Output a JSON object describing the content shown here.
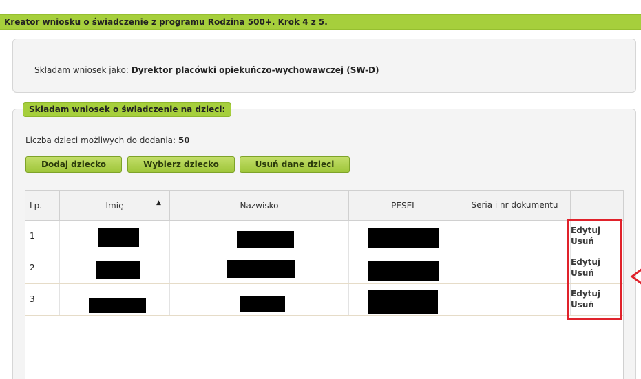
{
  "header": {
    "title": "Kreator wniosku o świadczenie z programu Rodzina 500+. Krok 4 z 5."
  },
  "role": {
    "prefix": "Składam wniosek jako:",
    "value": "Dyrektor placówki opiekuńczo-wychowawczej (SW-D)"
  },
  "children_section": {
    "legend": "Składam wniosek o świadczenie na dzieci:",
    "count_label": "Liczba dzieci możliwych do dodania:",
    "count_value": "50",
    "buttons": {
      "add": "Dodaj dziecko",
      "choose": "Wybierz dziecko",
      "remove": "Usuń dane dzieci"
    }
  },
  "table": {
    "columns": {
      "lp": "Lp.",
      "imie": "Imię",
      "nazwisko": "Nazwisko",
      "pesel": "PESEL",
      "seria": "Seria i nr dokumentu"
    },
    "sort_icon": "sort-ascending-icon",
    "rows": [
      {
        "lp": "1",
        "edit": "Edytuj",
        "delete": "Usuń"
      },
      {
        "lp": "2",
        "edit": "Edytuj",
        "delete": "Usuń"
      },
      {
        "lp": "3",
        "edit": "Edytuj",
        "delete": "Usuń"
      }
    ]
  },
  "colors": {
    "accent_green": "#a6cf3c",
    "highlight_red": "#e0222b"
  }
}
